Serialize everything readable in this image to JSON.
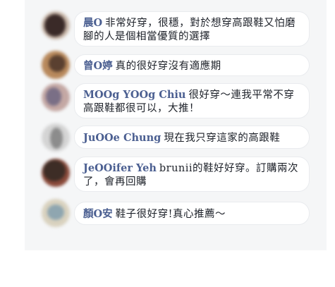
{
  "comments": [
    {
      "name": "晨O",
      "text": "非常好穿，很穩，對於想穿高跟鞋又怕磨腳的人是個相當優質的選擇",
      "avatar_colors": [
        "#3a2a28",
        "#c9b7a9"
      ]
    },
    {
      "name": "曾O婷",
      "text": "真的很好穿沒有適應期",
      "avatar_colors": [
        "#b8895c",
        "#5a4030"
      ]
    },
    {
      "name": "MOOg YOOg Chiu",
      "text": "很好穿～連我平常不穿高跟鞋都很可以，大推！",
      "avatar_colors": [
        "#7a6f86",
        "#c4a8a4"
      ]
    },
    {
      "name": "JuOOe Chung",
      "text": "現在我只穿這家的高跟鞋",
      "avatar_colors": [
        "#8c8c8c",
        "#d4d4d4"
      ]
    },
    {
      "name": "JeOOifer Yeh",
      "text": "brunii的鞋好好穿。訂購兩次了，會再回購",
      "avatar_colors": [
        "#3d2d26",
        "#8a4a3a"
      ]
    },
    {
      "name": "顏O安",
      "text": "鞋子很好穿!真心推薦～",
      "avatar_colors": [
        "#8fa6b0",
        "#d9d2bf"
      ]
    }
  ]
}
